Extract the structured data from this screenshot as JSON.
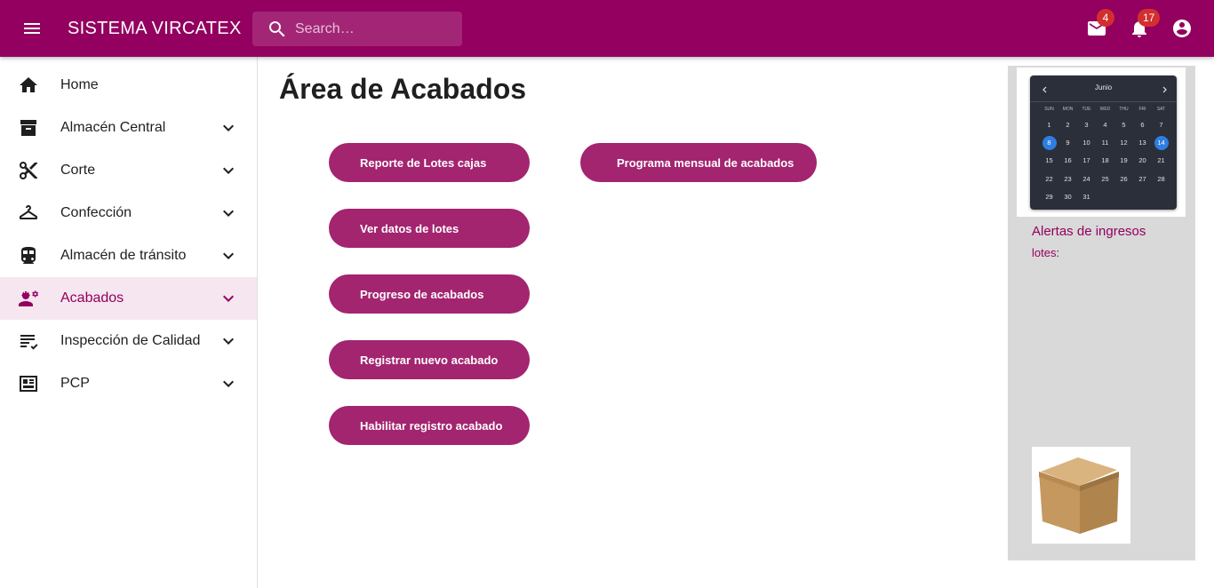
{
  "app": {
    "title": "SISTEMA VIRCATEX",
    "search_placeholder": "Search…",
    "mail_count": "4",
    "notification_count": "17",
    "brand_color": "#93005f"
  },
  "sidebar": {
    "items": [
      {
        "label": "Home",
        "icon": "home-icon"
      },
      {
        "label": "Almacén Central",
        "icon": "archive-icon"
      },
      {
        "label": "Corte",
        "icon": "scissors-icon"
      },
      {
        "label": "Confección",
        "icon": "hanger-icon"
      },
      {
        "label": "Almacén de tránsito",
        "icon": "train-icon"
      },
      {
        "label": "Acabados",
        "icon": "engineering-icon",
        "active": true
      },
      {
        "label": "Inspección de Calidad",
        "icon": "checklist-icon"
      },
      {
        "label": "PCP",
        "icon": "dashboard-icon"
      }
    ]
  },
  "main": {
    "title": "Área de Acabados",
    "buttons": {
      "reporte_lotes": "Reporte de Lotes cajas",
      "programa_mensual": "Programa mensual de acabados",
      "ver_datos": "Ver datos de lotes",
      "progreso": "Progreso de acabados",
      "registrar": "Registrar nuevo acabado",
      "habilitar": "Habilitar registro acabado"
    },
    "button_color": "#a3246f"
  },
  "calendar": {
    "month": "Junio",
    "weekdays": [
      "SUN",
      "MON",
      "TUE",
      "WED",
      "THU",
      "FRI",
      "SAT"
    ],
    "days": [
      "1",
      "2",
      "3",
      "4",
      "5",
      "6",
      "7",
      "8",
      "9",
      "10",
      "11",
      "12",
      "13",
      "14",
      "15",
      "16",
      "17",
      "18",
      "19",
      "20",
      "21",
      "22",
      "23",
      "24",
      "25",
      "26",
      "27",
      "28",
      "29",
      "30",
      "31"
    ],
    "selected_days": [
      "8",
      "14"
    ],
    "accent_color": "#2f7de1"
  },
  "alerts": {
    "title": "Alertas de ingresos",
    "subtitle": "lotes:"
  }
}
